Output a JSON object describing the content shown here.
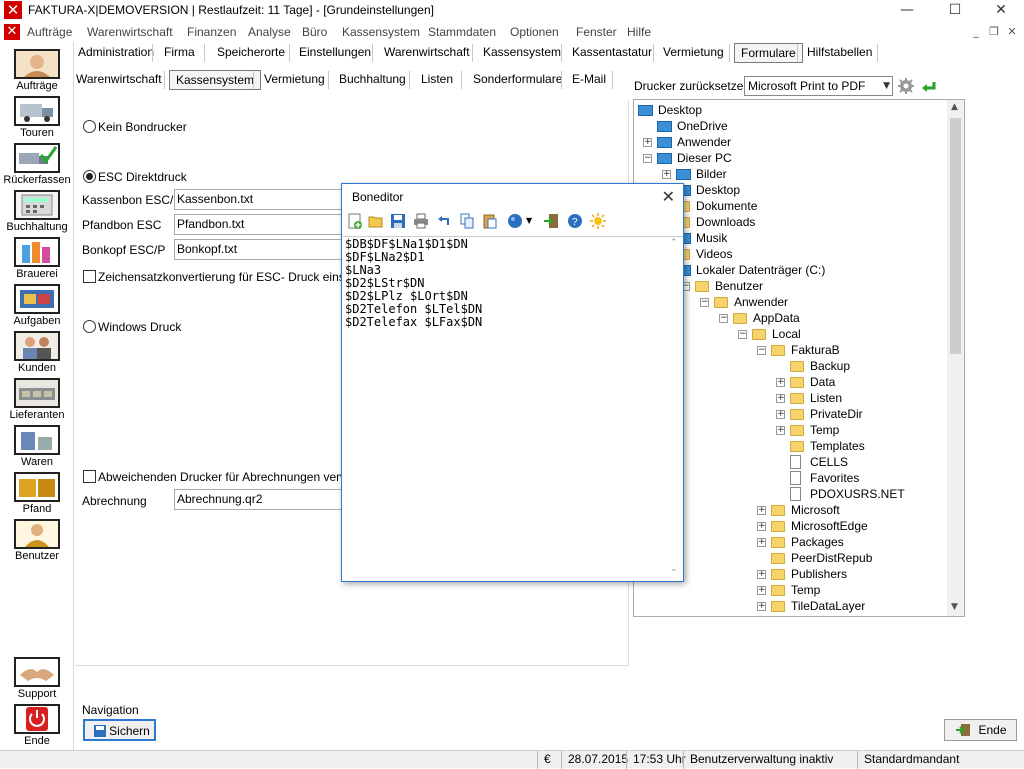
{
  "window": {
    "title": "FAKTURA-X|DEMOVERSION | Restlaufzeit: 11 Tage] - [Grundeinstellungen]"
  },
  "menu": {
    "items": [
      "Aufträge",
      "Warenwirtschaft",
      "Finanzen",
      "Analyse",
      "Büro",
      "Kassensystem",
      "Stammdaten",
      "Optionen",
      "Fenster",
      "Hilfe"
    ]
  },
  "leftnav": {
    "items": [
      "Aufträge",
      "Touren",
      "Rückerfassen",
      "Buchhaltung",
      "Brauerei",
      "Aufgaben",
      "Kunden",
      "Lieferanten",
      "Waren",
      "Pfand",
      "Benutzer"
    ],
    "support": "Support",
    "exit": "Ende"
  },
  "tabs1": [
    "Administration",
    "Firma",
    "Speicherorte",
    "Einstellungen",
    "Warenwirtschaft",
    "Kassensystem",
    "Kassentastatur",
    "Vermietung",
    "Formulare",
    "Hilfstabellen"
  ],
  "tabs1_selected": "Formulare",
  "tabs2": [
    "Warenwirtschaft",
    "Kassensystem",
    "Vermietung",
    "Buchhaltung",
    "Listen",
    "Sonderformulare",
    "E-Mail"
  ],
  "tabs2_selected": "Kassensystem",
  "form": {
    "kein_bondrucker": "Kein Bondrucker",
    "esc_direktdruck": "ESC Direktdruck",
    "kassenbon_label": "Kassenbon ESC/P",
    "kassenbon_value": "Kassenbon.txt",
    "pfandbon_label": "Pfandbon ESC",
    "pfandbon_value": "Pfandbon.txt",
    "bonkopf_label": "Bonkopf ESC/P",
    "bonkopf_value": "Bonkopf.txt",
    "zeichensatz": "Zeichensatzkonvertierung für ESC- Druck einschalt",
    "windows_druck": "Windows Druck",
    "abweichend": "Abweichenden Drucker für Abrechnungen verwend",
    "abrechnung_label": "Abrechnung",
    "abrechnung_value": "Abrechnung.qr2"
  },
  "printer_reset": {
    "label": "Drucker zurücksetzen:",
    "value": "Microsoft Print to PDF"
  },
  "tree": [
    {
      "label": "Desktop",
      "depth": 0,
      "icon": "desktop-icon",
      "exp": ""
    },
    {
      "label": "OneDrive",
      "depth": 1,
      "icon": "cloud-icon",
      "exp": ""
    },
    {
      "label": "Anwender",
      "depth": 1,
      "icon": "user-icon",
      "exp": "+"
    },
    {
      "label": "Dieser PC",
      "depth": 1,
      "icon": "pc-icon",
      "exp": "-"
    },
    {
      "label": "Bilder",
      "depth": 2,
      "icon": "pictures-icon",
      "exp": "+"
    },
    {
      "label": "Desktop",
      "depth": 2,
      "icon": "desktop-icon",
      "exp": ""
    },
    {
      "label": "Dokumente",
      "depth": 2,
      "icon": "folder-icon",
      "exp": ""
    },
    {
      "label": "Downloads",
      "depth": 2,
      "icon": "folder-icon",
      "exp": ""
    },
    {
      "label": "Musik",
      "depth": 2,
      "icon": "music-icon",
      "exp": ""
    },
    {
      "label": "Videos",
      "depth": 2,
      "icon": "folder-icon",
      "exp": ""
    },
    {
      "label": "Lokaler Datenträger (C:)",
      "depth": 2,
      "icon": "drive-icon",
      "exp": ""
    },
    {
      "label": "Benutzer",
      "depth": 3,
      "icon": "folder-icon",
      "exp": "-"
    },
    {
      "label": "Anwender",
      "depth": 4,
      "icon": "folder-icon",
      "exp": "-"
    },
    {
      "label": "AppData",
      "depth": 5,
      "icon": "folder-icon",
      "exp": "-"
    },
    {
      "label": "Local",
      "depth": 6,
      "icon": "folder-icon",
      "exp": "-"
    },
    {
      "label": "FakturaB",
      "depth": 7,
      "icon": "folder-icon",
      "exp": "-"
    },
    {
      "label": "Backup",
      "depth": 8,
      "icon": "folder-icon",
      "exp": ""
    },
    {
      "label": "Data",
      "depth": 8,
      "icon": "folder-icon",
      "exp": "+"
    },
    {
      "label": "Listen",
      "depth": 8,
      "icon": "folder-icon",
      "exp": "+"
    },
    {
      "label": "PrivateDir",
      "depth": 8,
      "icon": "folder-icon",
      "exp": "+"
    },
    {
      "label": "Temp",
      "depth": 8,
      "icon": "folder-icon",
      "exp": "+"
    },
    {
      "label": "Templates",
      "depth": 8,
      "icon": "folder-icon",
      "exp": ""
    },
    {
      "label": "CELLS",
      "depth": 8,
      "icon": "file-icon",
      "exp": ""
    },
    {
      "label": "Favorites",
      "depth": 8,
      "icon": "file-icon",
      "exp": ""
    },
    {
      "label": "PDOXUSRS.NET",
      "depth": 8,
      "icon": "file-icon",
      "exp": ""
    },
    {
      "label": "Microsoft",
      "depth": 7,
      "icon": "folder-icon",
      "exp": "+"
    },
    {
      "label": "MicrosoftEdge",
      "depth": 7,
      "icon": "folder-icon",
      "exp": "+"
    },
    {
      "label": "Packages",
      "depth": 7,
      "icon": "folder-icon",
      "exp": "+"
    },
    {
      "label": "PeerDistRepub",
      "depth": 7,
      "icon": "folder-icon",
      "exp": ""
    },
    {
      "label": "Publishers",
      "depth": 7,
      "icon": "folder-icon",
      "exp": "+"
    },
    {
      "label": "Temp",
      "depth": 7,
      "icon": "folder-icon",
      "exp": "+"
    },
    {
      "label": "TileDataLayer",
      "depth": 7,
      "icon": "folder-icon",
      "exp": "+"
    }
  ],
  "dialog": {
    "title": "Boneditor",
    "lines": [
      "$DB$DF$LNa1$D1$DN",
      "$DF$LNa2$D1",
      "$LNa3",
      "$D2$LStr$DN",
      "$D2$LPlz $LOrt$DN",
      "$D2Telefon $LTel$DN",
      "$D2Telefax $LFax$DN"
    ],
    "toolbar_icons": [
      "new-icon",
      "open-icon",
      "save-icon",
      "print-icon",
      "undo-icon",
      "copy-icon",
      "paste-icon",
      "color-icon",
      "dropdown-arrow-icon",
      "export-icon",
      "help-icon",
      "sun-icon"
    ]
  },
  "navigation": {
    "label": "Navigation",
    "save": "Sichern",
    "end": "Ende"
  },
  "status": {
    "currency": "€",
    "date": "28.07.2015",
    "time": "17:53 Uhr",
    "users": "Benutzerverwaltung inaktiv",
    "mandant": "Standardmandant"
  },
  "colors": {
    "brand": "#d40000",
    "accent": "#2b79d1"
  }
}
